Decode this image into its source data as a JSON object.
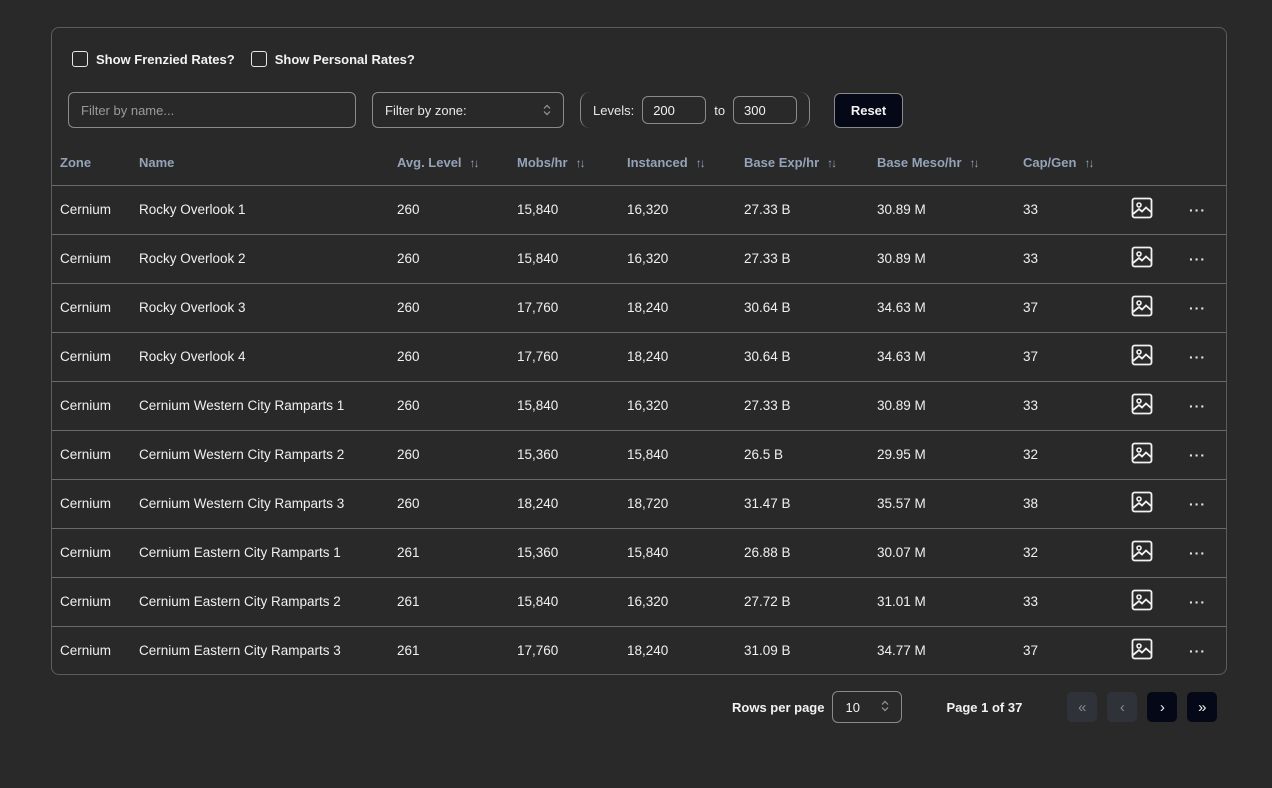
{
  "filters": {
    "frenzied_label": "Show Frenzied Rates?",
    "personal_label": "Show Personal Rates?",
    "name_placeholder": "Filter by name...",
    "zone_placeholder": "Filter by zone:",
    "levels_label": "Levels:",
    "level_min": "200",
    "level_sep": "to",
    "level_max": "300",
    "reset_label": "Reset"
  },
  "table": {
    "headers": [
      "Zone",
      "Name",
      "Avg. Level",
      "Mobs/hr",
      "Instanced",
      "Base Exp/hr",
      "Base Meso/hr",
      "Cap/Gen"
    ],
    "rows": [
      [
        "Cernium",
        "Rocky Overlook 1",
        "260",
        "15,840",
        "16,320",
        "27.33 B",
        "30.89 M",
        "33"
      ],
      [
        "Cernium",
        "Rocky Overlook 2",
        "260",
        "15,840",
        "16,320",
        "27.33 B",
        "30.89 M",
        "33"
      ],
      [
        "Cernium",
        "Rocky Overlook 3",
        "260",
        "17,760",
        "18,240",
        "30.64 B",
        "34.63 M",
        "37"
      ],
      [
        "Cernium",
        "Rocky Overlook 4",
        "260",
        "17,760",
        "18,240",
        "30.64 B",
        "34.63 M",
        "37"
      ],
      [
        "Cernium",
        "Cernium Western City Ramparts 1",
        "260",
        "15,840",
        "16,320",
        "27.33 B",
        "30.89 M",
        "33"
      ],
      [
        "Cernium",
        "Cernium Western City Ramparts 2",
        "260",
        "15,360",
        "15,840",
        "26.5 B",
        "29.95 M",
        "32"
      ],
      [
        "Cernium",
        "Cernium Western City Ramparts 3",
        "260",
        "18,240",
        "18,720",
        "31.47 B",
        "35.57 M",
        "38"
      ],
      [
        "Cernium",
        "Cernium Eastern City Ramparts 1",
        "261",
        "15,360",
        "15,840",
        "26.88 B",
        "30.07 M",
        "32"
      ],
      [
        "Cernium",
        "Cernium Eastern City Ramparts 2",
        "261",
        "15,840",
        "16,320",
        "27.72 B",
        "31.01 M",
        "33"
      ],
      [
        "Cernium",
        "Cernium Eastern City Ramparts 3",
        "261",
        "17,760",
        "18,240",
        "31.09 B",
        "34.77 M",
        "37"
      ]
    ],
    "row_image_icon": "image-icon",
    "row_more_icon": "more-horizontal-icon"
  },
  "pagination": {
    "rows_per_page_label": "Rows per page",
    "rows_per_page_value": "10",
    "page_info": "Page 1 of 37",
    "first_icon": "«",
    "prev_icon": "‹",
    "next_icon": "›",
    "last_icon": "»"
  },
  "colors": {
    "background": "#292929",
    "header_text": "#94a3b8",
    "button_dark": "#050816",
    "button_disabled": "#30323a"
  }
}
